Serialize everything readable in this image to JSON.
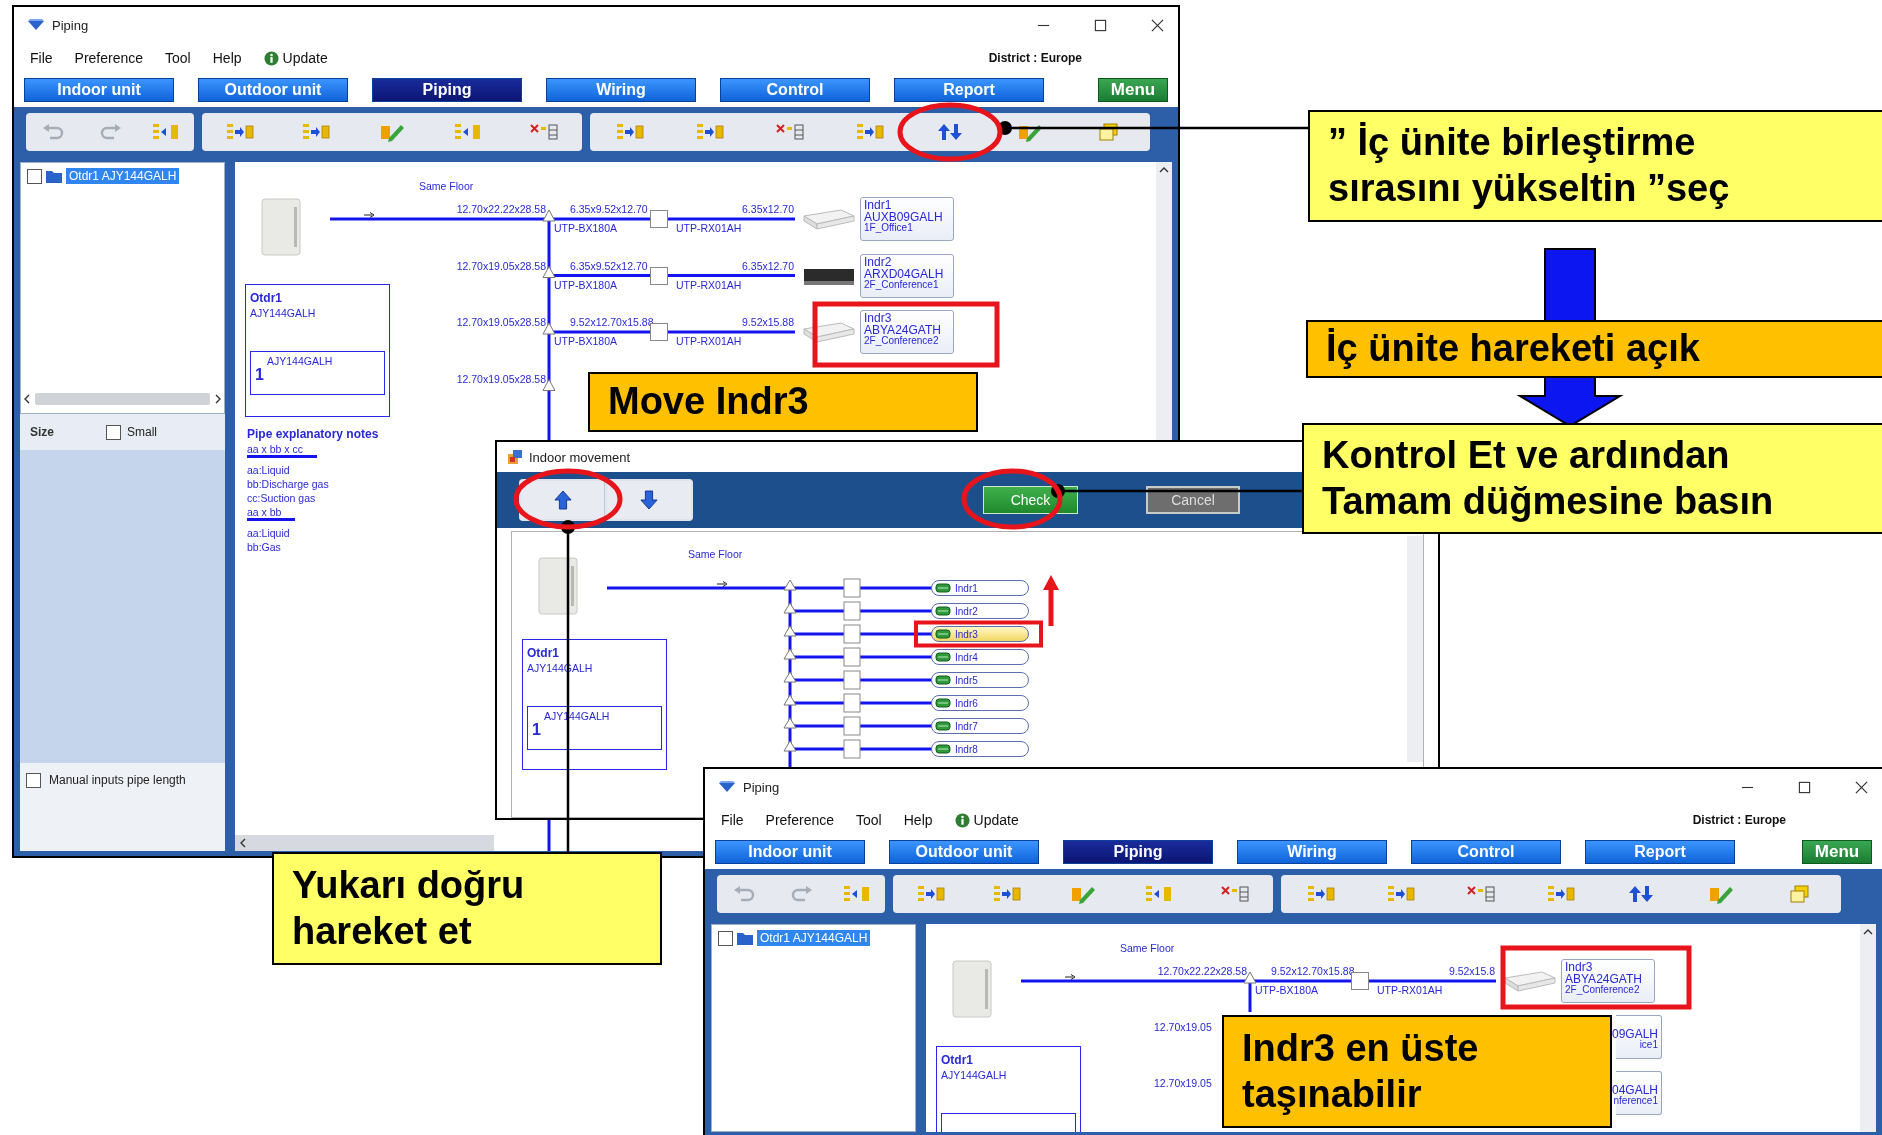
{
  "piping_windows": [
    {
      "title": "Piping",
      "menu": [
        "File",
        "Preference",
        "Tool",
        "Help"
      ],
      "update": "Update",
      "district": "District : Europe",
      "tabs": [
        {
          "label": "Indoor unit",
          "selected": false
        },
        {
          "label": "Outdoor unit",
          "selected": false
        },
        {
          "label": "Piping",
          "selected": true
        },
        {
          "label": "Wiring",
          "selected": false
        },
        {
          "label": "Control",
          "selected": false
        },
        {
          "label": "Report",
          "selected": false
        }
      ],
      "menu_button": "Menu",
      "tree_item": {
        "label": "Otdr1 AJY144GALH",
        "checked": false,
        "selected": true
      },
      "size": {
        "label": "Size",
        "option": "Small",
        "checked": false
      },
      "manual_inputs": {
        "label": "Manual inputs pipe length",
        "checked": false
      },
      "diagram": {
        "same_floor": "Same Floor",
        "outdoor": {
          "name": "Otdr1",
          "model": "AJY144GALH",
          "inner_model": "AJY144GALH",
          "count": "1"
        },
        "notes": {
          "title": "Pipe explanatory notes",
          "groups": [
            {
              "header": "aa x bb x cc",
              "lines": [
                "aa:Liquid",
                "bb:Discharge gas",
                "cc:Suction gas"
              ]
            },
            {
              "header": "aa x bb",
              "lines": [
                "aa:Liquid",
                "bb:Gas"
              ]
            }
          ]
        },
        "rows": [
          {
            "kind": "full",
            "main_pipe": "12.70x22.22x28.58",
            "branch_pipe": "6.35x9.52x12.70",
            "branch_kit": "UTP-BX180A",
            "adapter": "UTP-RX01AH",
            "end_pipe": "6.35x12.70",
            "unit": {
              "kind": "cassette",
              "name": "Indr1",
              "model": "AUXB09GALH",
              "room": "1F_Office1"
            }
          },
          {
            "kind": "full",
            "main_pipe": "12.70x19.05x28.58",
            "branch_pipe": "6.35x9.52x12.70",
            "branch_kit": "UTP-BX180A",
            "adapter": "UTP-RX01AH",
            "end_pipe": "6.35x12.70",
            "unit": {
              "kind": "duct",
              "name": "Indr2",
              "model": "ARXD04GALH",
              "room": "2F_Conference1"
            }
          },
          {
            "kind": "full",
            "main_pipe": "12.70x19.05x28.58",
            "branch_pipe": "9.52x12.70x15.88",
            "branch_kit": "UTP-BX180A",
            "adapter": "UTP-RX01AH",
            "end_pipe": "9.52x15.88",
            "unit": {
              "kind": "cassette",
              "name": "Indr3",
              "model": "ABYA24GATH",
              "room": "2F_Conference2"
            }
          },
          {
            "kind": "full",
            "main_pipe": "12.70x19.05x28.58"
          }
        ]
      }
    },
    {
      "title": "Piping",
      "menu": [
        "File",
        "Preference",
        "Tool",
        "Help"
      ],
      "update": "Update",
      "district": "District : Europe",
      "tabs": [
        {
          "label": "Indoor unit",
          "selected": false
        },
        {
          "label": "Outdoor unit",
          "selected": false
        },
        {
          "label": "Piping",
          "selected": true
        },
        {
          "label": "Wiring",
          "selected": false
        },
        {
          "label": "Control",
          "selected": false
        },
        {
          "label": "Report",
          "selected": false
        }
      ],
      "menu_button": "Menu",
      "tree_item": {
        "label": "Otdr1 AJY144GALH",
        "checked": false,
        "selected": true
      },
      "diagram": {
        "same_floor": "Same Floor",
        "outdoor": {
          "name": "Otdr1",
          "model": "AJY144GALH"
        },
        "rows": [
          {
            "kind": "full",
            "main_pipe": "12.70x22.22x28.58",
            "branch_pipe": "9.52x12.70x15.88",
            "branch_kit": "UTP-BX180A",
            "adapter": "UTP-RX01AH",
            "end_pipe": "9.52x15.8",
            "unit": {
              "kind": "cassette",
              "name": "Indr3",
              "model": "ABYA24GATH",
              "room": "2F_Conference2"
            }
          },
          {
            "kind": "cut",
            "main_pipe": "12.70x19.05",
            "unit": {
              "model": "09GALH",
              "room": "ice1"
            }
          },
          {
            "kind": "cut",
            "main_pipe": "12.70x19.05",
            "unit": {
              "model": "04GALH",
              "room": "nference1"
            }
          }
        ]
      }
    }
  ],
  "dialog": {
    "title": "Indoor movement",
    "check": "Check",
    "cancel": "Cancel",
    "diagram": {
      "same_floor": "Same Floor",
      "outdoor": {
        "name": "Otdr1",
        "model": "AJY144GALH",
        "inner_model": "AJY144GALH",
        "count": "1"
      },
      "units": [
        {
          "name": "Indr1",
          "selected": false
        },
        {
          "name": "Indr2",
          "selected": false
        },
        {
          "name": "Indr3",
          "selected": true
        },
        {
          "name": "Indr4",
          "selected": false
        },
        {
          "name": "Indr5",
          "selected": false
        },
        {
          "name": "Indr6",
          "selected": false
        },
        {
          "name": "Indr7",
          "selected": false
        },
        {
          "name": "Indr8",
          "selected": false
        }
      ]
    }
  },
  "callouts": [
    {
      "kind": "note",
      "text": "” İç ünite birleştirme sırasını yükseltin ”seç"
    },
    {
      "kind": "step",
      "text": "İç ünite hareketi açık"
    },
    {
      "kind": "note",
      "text": "Kontrol Et ve ardından Tamam düğmesine basın"
    },
    {
      "kind": "step",
      "text": "Move Indr3"
    },
    {
      "kind": "note",
      "text": "Yukarı doğru hareket et"
    },
    {
      "kind": "step",
      "text": "Indr3 en üste taşınabilir"
    }
  ]
}
